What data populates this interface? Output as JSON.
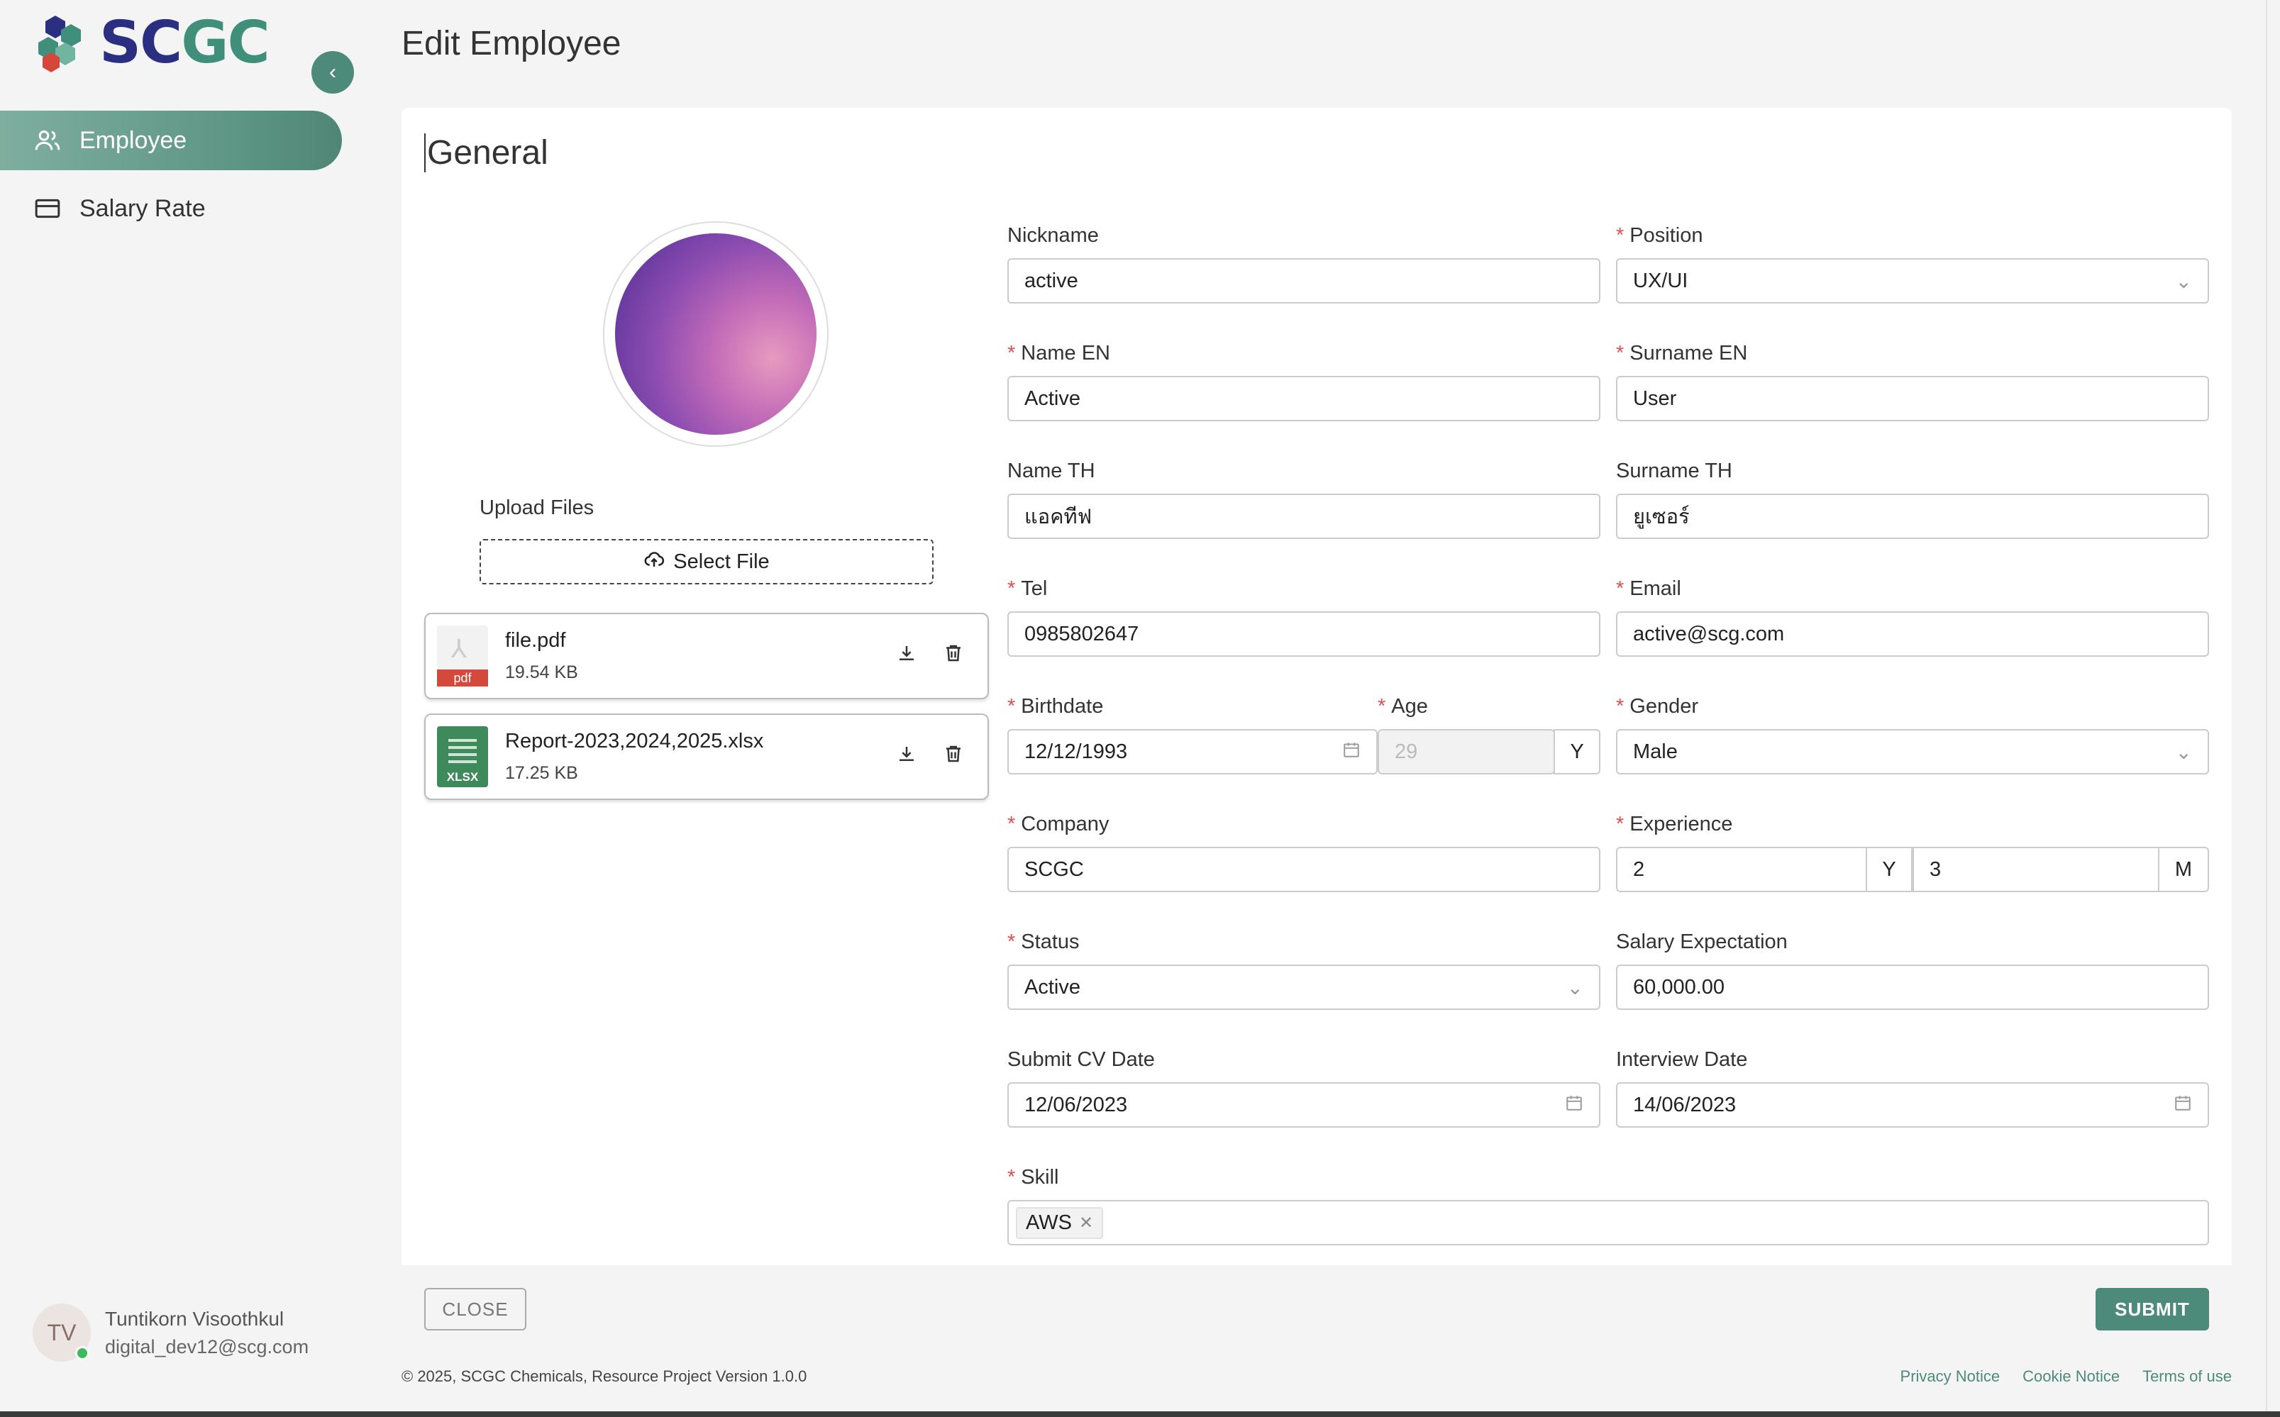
{
  "brand": {
    "logo_text_part1": "SC",
    "logo_text_part2": "GC",
    "colors": {
      "accent": "#4e8a79",
      "required": "#e05050",
      "brand_navy": "#2b2f82",
      "brand_green": "#3f8f7a"
    }
  },
  "sidebar": {
    "collapse_icon": "chevron-left-icon",
    "items": [
      {
        "label": "Employee",
        "icon": "users-icon",
        "active": true
      },
      {
        "label": "Salary Rate",
        "icon": "credit-card-icon",
        "active": false
      }
    ],
    "user": {
      "initials": "TV",
      "name": "Tuntikorn Visoothkul",
      "email": "digital_dev12@scg.com"
    }
  },
  "page": {
    "title": "Edit Employee",
    "section": "General"
  },
  "upload": {
    "label": "Upload Files",
    "button": "Select File",
    "files": [
      {
        "name": "file.pdf",
        "size": "19.54 KB",
        "type_tag": "pdf"
      },
      {
        "name": "Report-2023,2024,2025.xlsx",
        "size": "17.25 KB",
        "type_tag": "XLSX"
      }
    ]
  },
  "form": {
    "nickname": {
      "label": "Nickname",
      "value": "active"
    },
    "position": {
      "label": "Position",
      "value": "UX/UI"
    },
    "name_en": {
      "label": "Name EN",
      "value": "Active"
    },
    "surname_en": {
      "label": "Surname EN",
      "value": "User"
    },
    "name_th": {
      "label": "Name TH",
      "value": "แอคทีฟ"
    },
    "surname_th": {
      "label": "Surname TH",
      "value": "ยูเซอร์"
    },
    "tel": {
      "label": "Tel",
      "value": "0985802647"
    },
    "email": {
      "label": "Email",
      "value": "active@scg.com"
    },
    "birthdate": {
      "label": "Birthdate",
      "value": "12/12/1993"
    },
    "age": {
      "label": "Age",
      "value": "29",
      "unit": "Y"
    },
    "gender": {
      "label": "Gender",
      "value": "Male"
    },
    "company": {
      "label": "Company",
      "value": "SCGC"
    },
    "experience": {
      "label": "Experience",
      "years": "2",
      "years_unit": "Y",
      "months": "3",
      "months_unit": "M"
    },
    "status": {
      "label": "Status",
      "value": "Active"
    },
    "salary_expectation": {
      "label": "Salary Expectation",
      "value": "60,000.00"
    },
    "submit_cv_date": {
      "label": "Submit CV Date",
      "value": "12/06/2023"
    },
    "interview_date": {
      "label": "Interview Date",
      "value": "14/06/2023"
    },
    "skill": {
      "label": "Skill",
      "tags": [
        "AWS"
      ]
    }
  },
  "actions": {
    "close": "CLOSE",
    "submit": "SUBMIT"
  },
  "footer": {
    "copyright": "© 2025, SCGC Chemicals, Resource Project Version 1.0.0",
    "links": [
      "Privacy Notice",
      "Cookie Notice",
      "Terms of use"
    ]
  }
}
